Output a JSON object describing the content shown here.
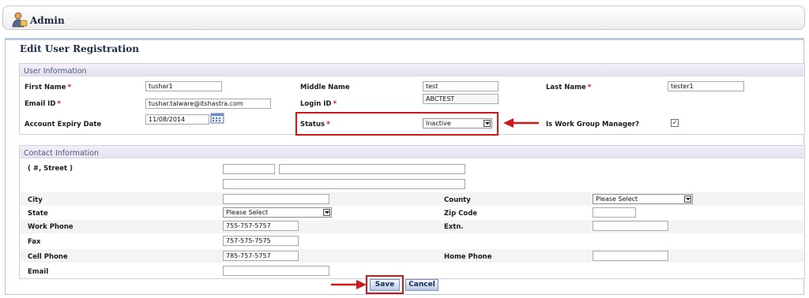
{
  "header": {
    "title": "Admin",
    "icon": "user-admin-icon"
  },
  "page": {
    "title": "Edit User Registration"
  },
  "user_info": {
    "section_title": "User Information",
    "first_name": {
      "label": "First Name",
      "value": "tushar1"
    },
    "middle_name": {
      "label": "Middle Name",
      "value": "test"
    },
    "last_name": {
      "label": "Last Name",
      "value": "tester1"
    },
    "email": {
      "label": "Email ID",
      "value": "tushar.talware@itshastra.com"
    },
    "login_id": {
      "label": "Login ID",
      "value": "ABCTEST"
    },
    "account_expiry": {
      "label": "Account Expiry Date",
      "value": "11/08/2014",
      "icon": "calendar-icon"
    },
    "status": {
      "label": "Status",
      "value": "Inactive"
    },
    "work_group_manager": {
      "label": "Is Work Group Manager?",
      "checked": true,
      "mark": "✓"
    }
  },
  "contact_info": {
    "section_title": "Contact Information",
    "street": {
      "label": "( #, Street )",
      "number": "",
      "street": "",
      "line2": ""
    },
    "city": {
      "label": "City",
      "value": ""
    },
    "county": {
      "label": "County",
      "value": "Please Select"
    },
    "state": {
      "label": "State",
      "value": "Please Select"
    },
    "zip": {
      "label": "Zip Code",
      "value": ""
    },
    "work_phone": {
      "label": "Work Phone",
      "value": "755-757-5757"
    },
    "extn": {
      "label": "Extn.",
      "value": ""
    },
    "fax": {
      "label": "Fax",
      "value": "757-575-7575"
    },
    "cell_phone": {
      "label": "Cell Phone",
      "value": "785-757-5757"
    },
    "home_phone": {
      "label": "Home Phone",
      "value": ""
    },
    "email": {
      "label": "Email",
      "value": ""
    }
  },
  "required_marker": "*",
  "actions": {
    "save_label": "Save",
    "cancel_label": "Cancel"
  },
  "colors": {
    "highlight": "#d01919",
    "section_header": "#e6e1ef",
    "button": "#b9c9e6"
  }
}
